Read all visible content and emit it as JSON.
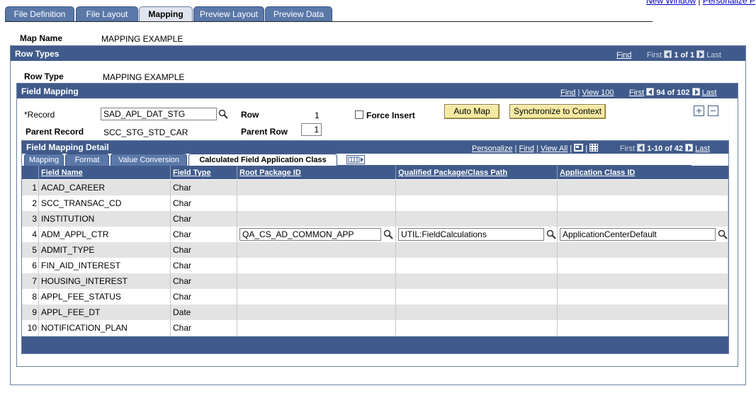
{
  "top_links": {
    "new_window": "New Window",
    "separator": "|",
    "personalize": "Personalize P"
  },
  "tabs": [
    "File Definition",
    "File Layout",
    "Mapping",
    "Preview Layout",
    "Preview Data"
  ],
  "map_name": {
    "label": "Map Name",
    "value": "MAPPING EXAMPLE"
  },
  "row_types": {
    "title": "Row Types",
    "find": "Find",
    "first": "First",
    "count": "1 of 1",
    "last": "Last",
    "row_type_label": "Row Type",
    "row_type_value": "MAPPING EXAMPLE"
  },
  "field_mapping": {
    "title": "Field Mapping",
    "find": "Find",
    "sep": "|",
    "view": "View 100",
    "first": "First",
    "count": "94 of 102",
    "last": "Last",
    "record_label": "*Record",
    "record_value": "SAD_APL_DAT_STG",
    "row_label": "Row",
    "row_value": "1",
    "force_insert_label": "Force Insert",
    "auto_map": "Auto Map",
    "sync_context": "Synchronize to Context",
    "parent_record_label": "Parent Record",
    "parent_record_value": "SCC_STG_STD_CAR",
    "parent_row_label": "Parent Row",
    "parent_row_value": "1"
  },
  "detail": {
    "title": "Field Mapping Detail",
    "personalize": "Personalize",
    "find": "Find",
    "view_all": "View All",
    "first": "First",
    "count": "1-10 of 42",
    "last": "Last",
    "subtabs": [
      "Mapping",
      "Format",
      "Value Conversion",
      "Calculated Field Application Class"
    ],
    "columns": [
      "Field Name",
      "Field Type",
      "Root Package ID",
      "Qualified Package/Class Path",
      "Application Class ID"
    ],
    "rows": [
      {
        "num": "1",
        "field": "ACAD_CAREER",
        "type": "Char"
      },
      {
        "num": "2",
        "field": "SCC_TRANSAC_CD",
        "type": "Char"
      },
      {
        "num": "3",
        "field": "INSTITUTION",
        "type": "Char"
      },
      {
        "num": "4",
        "field": "ADM_APPL_CTR",
        "type": "Char",
        "root_pkg": "QA_CS_AD_COMMON_APP",
        "class_path": "UTIL:FieldCalculations",
        "app_class": "ApplicationCenterDefault"
      },
      {
        "num": "5",
        "field": "ADMIT_TYPE",
        "type": "Char"
      },
      {
        "num": "6",
        "field": "FIN_AID_INTEREST",
        "type": "Char"
      },
      {
        "num": "7",
        "field": "HOUSING_INTEREST",
        "type": "Char"
      },
      {
        "num": "8",
        "field": "APPL_FEE_STATUS",
        "type": "Char"
      },
      {
        "num": "9",
        "field": "APPL_FEE_DT",
        "type": "Date"
      },
      {
        "num": "10",
        "field": "NOTIFICATION_PLAN",
        "type": "Char"
      }
    ]
  },
  "colors": {
    "header_blue": "#405b8b",
    "tab_blue": "#5a78a8",
    "button_yellow": "#f5e9a3",
    "row_gray": "#e3e3e3"
  }
}
